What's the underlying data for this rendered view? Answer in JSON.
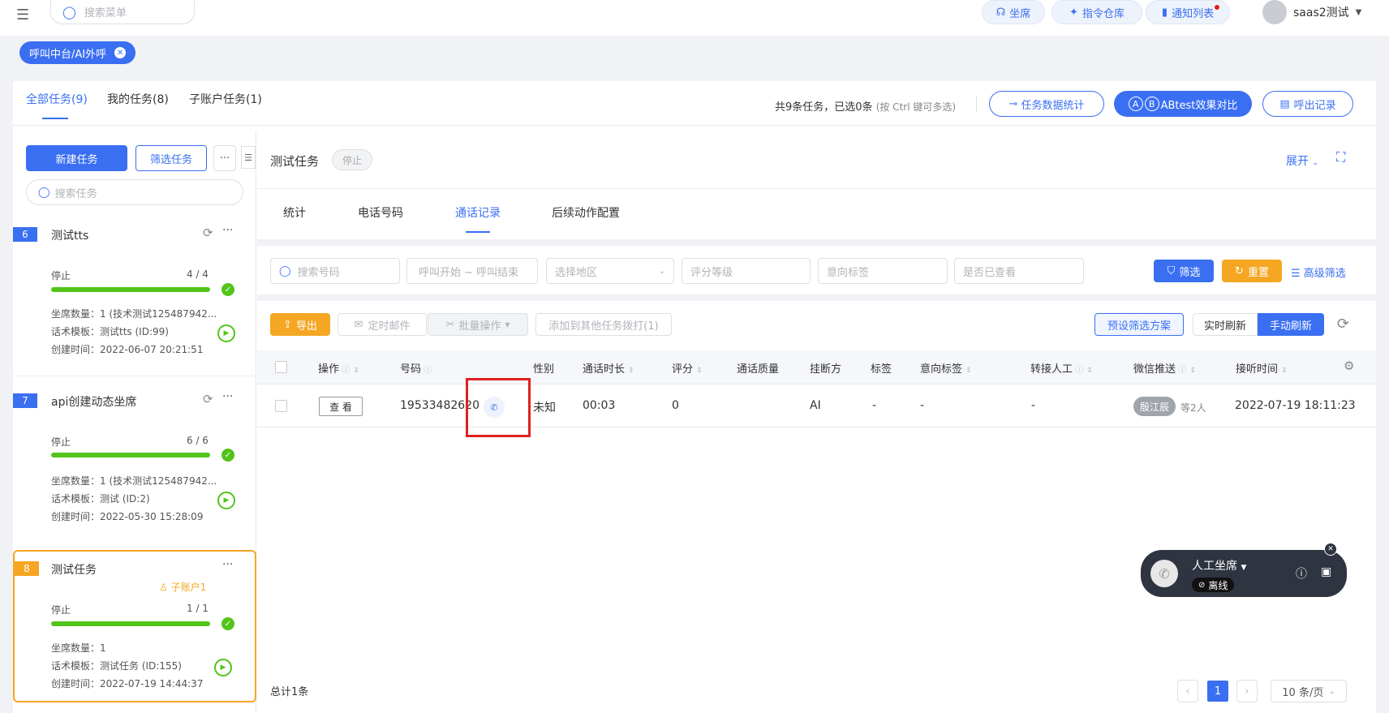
{
  "topbar": {
    "search_placeholder": "搜索菜单",
    "seat": "坐席",
    "command": "指令仓库",
    "notice": "通知列表",
    "user": "saas2测试"
  },
  "tag": {
    "label": "呼叫中台/AI外呼"
  },
  "top_tabs": [
    "全部任务(9)",
    "我的任务(8)",
    "子账户任务(1)"
  ],
  "summary": {
    "text": "共9条任务，已选0条",
    "hint": "(按 Ctrl 键可多选)",
    "stats_button": "任务数据统计",
    "abtest_button": "ABtest效果对比",
    "records_button": "呼出记录",
    "ab_a": "A",
    "ab_b": "B"
  },
  "left": {
    "new_task": "新建任务",
    "filter_task": "筛选任务",
    "more": "···",
    "search_placeholder": "搜索任务",
    "tasks": [
      {
        "num": "6",
        "title": "测试tts",
        "status": "停止",
        "progress_text": "4 / 4",
        "progress": 1.0,
        "seats": "坐席数量：1 (技术测试125487942...",
        "template": "话术模板：测试tts (ID:99)",
        "created": "创建时间：2022-06-07 20:21:51"
      },
      {
        "num": "7",
        "title": "api创建动态坐席",
        "status": "停止",
        "progress_text": "6 / 6",
        "progress": 1.0,
        "seats": "坐席数量：1 (技术测试125487942...",
        "template": "话术模板：测试 (ID:2)",
        "created": "创建时间：2022-05-30 15:28:09"
      },
      {
        "num": "8",
        "title": "测试任务",
        "sub": "子账户1",
        "status": "停止",
        "progress_text": "1 / 1",
        "progress": 1.0,
        "seats": "坐席数量：1",
        "template": "话术模板：测试任务 (ID:155)",
        "created": "创建时间：2022-07-19 14:44:37"
      }
    ]
  },
  "detail": {
    "title": "测试任务",
    "status": "停止",
    "expand": "展开",
    "tabs": [
      "统计",
      "电话号码",
      "通话记录",
      "后续动作配置"
    ],
    "active_tab": "通话记录"
  },
  "filters": {
    "search": "搜索号码",
    "time": "呼叫开始 ~ 呼叫结束",
    "region": "选择地区",
    "grade": "评分等级",
    "intent": "意向标签",
    "viewed": "是否已查看",
    "filter_btn": "筛选",
    "reset_btn": "重置",
    "advanced": "高级筛选"
  },
  "toolbar": {
    "export": "导出",
    "mail": "定时邮件",
    "batch": "批量操作",
    "add_other": "添加到其他任务拨打(1)",
    "preset": "预设筛选方案",
    "realtime": "实时刷新",
    "manual": "手动刷新"
  },
  "table": {
    "headers": [
      "操作",
      "号码",
      "性别",
      "通话时长",
      "评分",
      "通话质量",
      "挂断方",
      "标签",
      "意向标签",
      "转接人工",
      "微信推送",
      "接听时间"
    ],
    "row": {
      "action": "查 看",
      "phone": "19533482620",
      "gender": "未知",
      "duration": "00:03",
      "score": "0",
      "quality": "",
      "hangup": "AI",
      "label": "-",
      "intent": "-",
      "transfer": "-",
      "wechat_tag": "殷江辰",
      "wechat_more": "等2人",
      "answer_time": "2022-07-19 18:11:23"
    }
  },
  "footer": {
    "total": "总计1条",
    "page": "1",
    "page_size": "10 条/页"
  },
  "softphone": {
    "title": "人工坐席",
    "status": "离线"
  },
  "colors": {
    "primary": "#3a6ff2",
    "orange": "#f5a623",
    "green": "#52c41a",
    "highlight": "#e02020"
  }
}
